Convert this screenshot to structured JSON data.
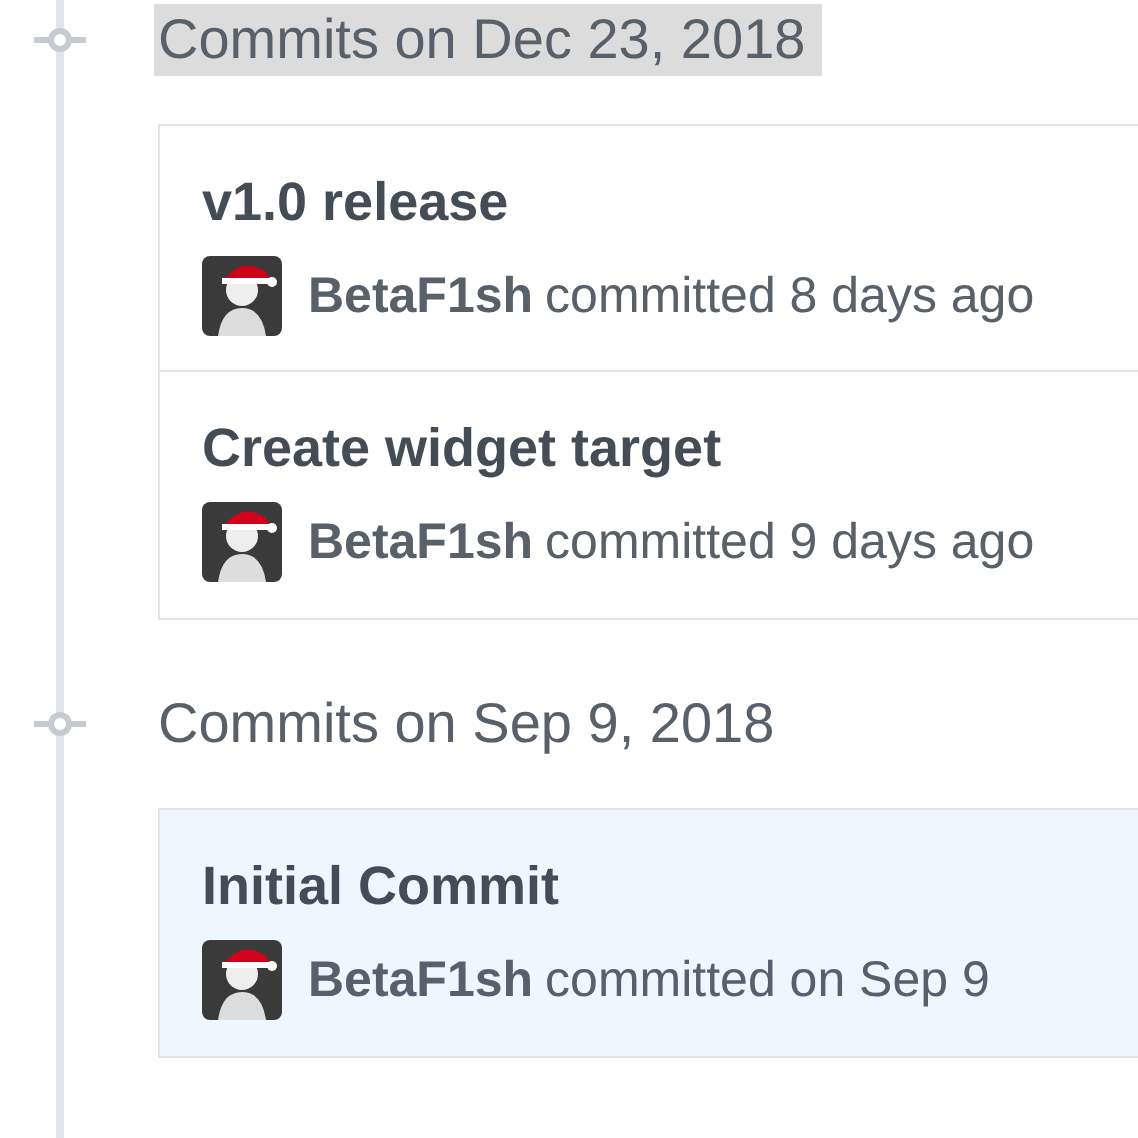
{
  "groups": [
    {
      "heading": "Commits on Dec 23, 2018",
      "highlighted": true,
      "commits": [
        {
          "title": "v1.0 release",
          "author": "BetaF1sh",
          "meta": "committed 8 days ago",
          "highlighted": false
        },
        {
          "title": "Create widget target",
          "author": "BetaF1sh",
          "meta": "committed 9 days ago",
          "highlighted": false
        }
      ]
    },
    {
      "heading": "Commits on Sep 9, 2018",
      "highlighted": false,
      "commits": [
        {
          "title": "Initial Commit",
          "author": "BetaF1sh",
          "meta": "committed on Sep 9",
          "highlighted": true
        }
      ]
    }
  ]
}
